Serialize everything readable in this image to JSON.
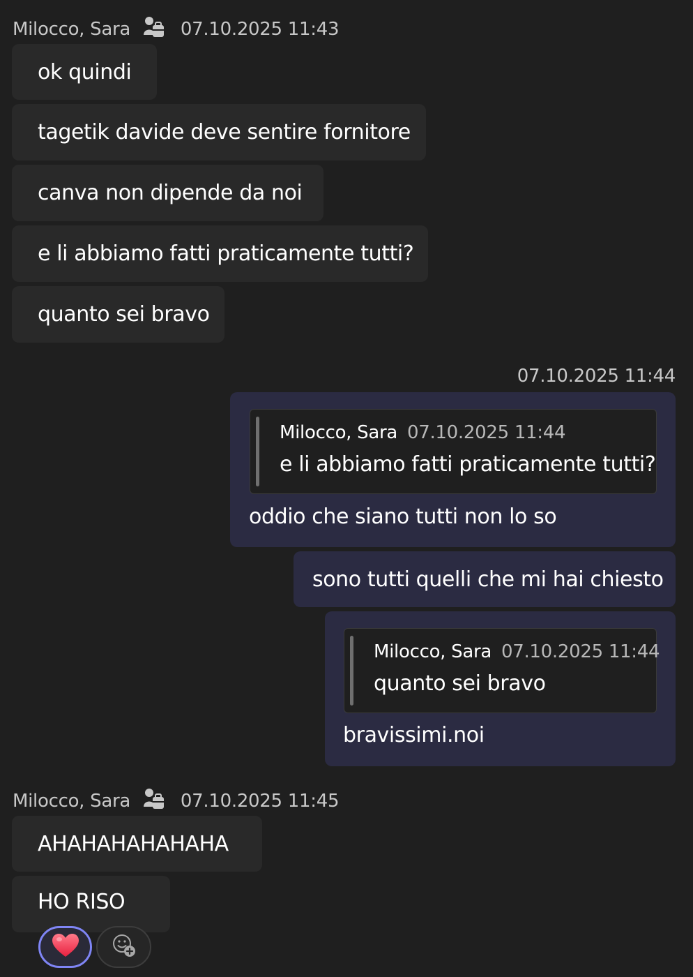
{
  "first_group": {
    "sender": "Milocco, Sara",
    "timestamp": "07.10.2025 11:43",
    "messages": [
      "ok quindi",
      "tagetik davide deve sentire fornitore",
      "canva non dipende da noi",
      "e li abbiamo fatti praticamente tutti?",
      "quanto sei bravo"
    ]
  },
  "outgoing_group": {
    "timestamp": "07.10.2025 11:44",
    "reply1": {
      "quote_sender": "Milocco, Sara",
      "quote_time": "07.10.2025 11:44",
      "quote_text": "e li abbiamo fatti praticamente tutti?",
      "text": "oddio che siano tutti non lo so"
    },
    "message2": "sono tutti quelli che mi hai chiesto",
    "reply2": {
      "quote_sender": "Milocco, Sara",
      "quote_time": "07.10.2025 11:44",
      "quote_text": "quanto sei bravo",
      "text": "bravissimi.noi"
    }
  },
  "second_group": {
    "sender": "Milocco, Sara",
    "timestamp": "07.10.2025 11:45",
    "messages": [
      "AHAHAHAHAHAHA",
      "HO RISO"
    ]
  },
  "reactions": {
    "heart": "heart-reaction",
    "add": "add-reaction-icon"
  },
  "colors": {
    "background": "#1f1f1f",
    "incoming_bubble": "#292929",
    "outgoing_bubble": "#2b2b42",
    "reaction_accent": "#7f85f5"
  }
}
